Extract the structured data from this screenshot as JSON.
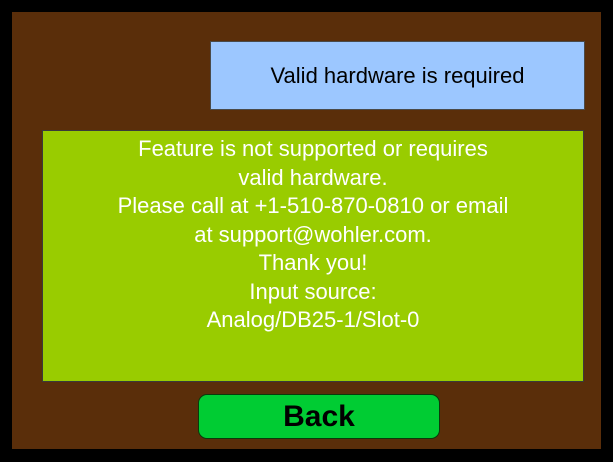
{
  "header": {
    "title": "Valid hardware is required"
  },
  "message": {
    "lines": [
      "Feature is not supported or requires",
      "valid hardware.",
      "Please call at +1-510-870-0810 or email",
      "at support@wohler.com.",
      "Thank you!",
      "Input source:",
      "Analog/DB25-1/Slot-0"
    ]
  },
  "actions": {
    "back_label": "Back"
  },
  "colors": {
    "frame": "#000000",
    "background": "#5a2e0a",
    "title_box": "#9cc7ff",
    "message_box": "#99cc00",
    "back_button": "#00cc33"
  }
}
